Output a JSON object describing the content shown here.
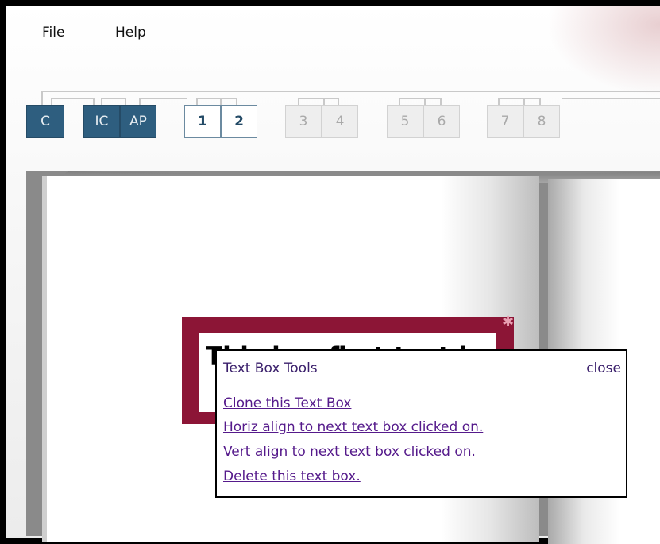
{
  "menu": {
    "file": "File",
    "help": "Help"
  },
  "pages": [
    "C",
    "IC",
    "AP",
    "1",
    "2",
    "3",
    "4",
    "5",
    "6",
    "7",
    "8"
  ],
  "textbox": {
    "text": "This is a first text box"
  },
  "tools": {
    "title": "Text Box Tools",
    "close": "close",
    "actions": [
      "Clone this Text Box",
      "Horiz align to next text box clicked on.",
      "Vert align to next text box clicked on.",
      "Delete this text box."
    ]
  },
  "colors": {
    "page_dark": "#2e5e7f",
    "page_active_text": "#234a66",
    "textbox_border": "#8c1536",
    "link": "#551a8b"
  }
}
